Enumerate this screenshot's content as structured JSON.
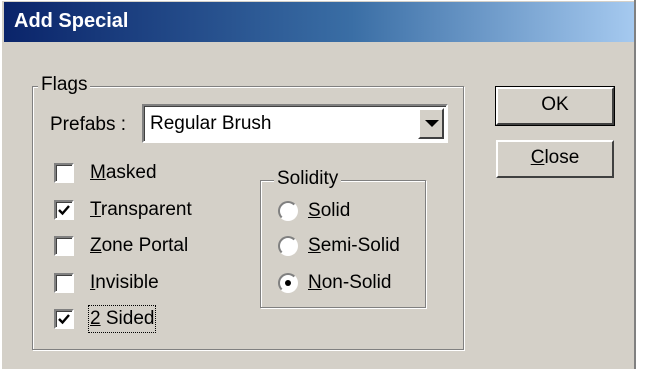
{
  "window": {
    "title": "Add Special"
  },
  "flags_group": {
    "legend": "Flags",
    "prefabs_label": "Prefabs :",
    "prefabs_value": "Regular Brush",
    "checkboxes": [
      {
        "mnemonic": "M",
        "rest": "asked",
        "checked": false
      },
      {
        "mnemonic": "T",
        "rest": "ransparent",
        "checked": true
      },
      {
        "mnemonic": "Z",
        "rest": "one Portal",
        "checked": false
      },
      {
        "mnemonic": "I",
        "rest": "nvisible",
        "checked": false
      },
      {
        "mnemonic": "2",
        "rest": " Sided",
        "checked": true
      }
    ]
  },
  "solidity_group": {
    "legend": "Solidity",
    "radios": [
      {
        "mnemonic": "S",
        "rest": "olid",
        "selected": false
      },
      {
        "mnemonic": "S",
        "rest": "emi-Solid",
        "selected": false
      },
      {
        "mnemonic": "N",
        "rest": "on-Solid",
        "selected": true
      }
    ]
  },
  "buttons": {
    "ok_label": "OK",
    "close_mnemonic": "C",
    "close_rest": "lose"
  },
  "colors": {
    "title_start": "#0a246a",
    "title_end": "#a6caf0",
    "face": "#d4d0c8"
  },
  "icons": {
    "combo_arrow": "chevron-down-icon",
    "check": "checkmark-icon",
    "radio_dot": "radio-dot-icon"
  }
}
